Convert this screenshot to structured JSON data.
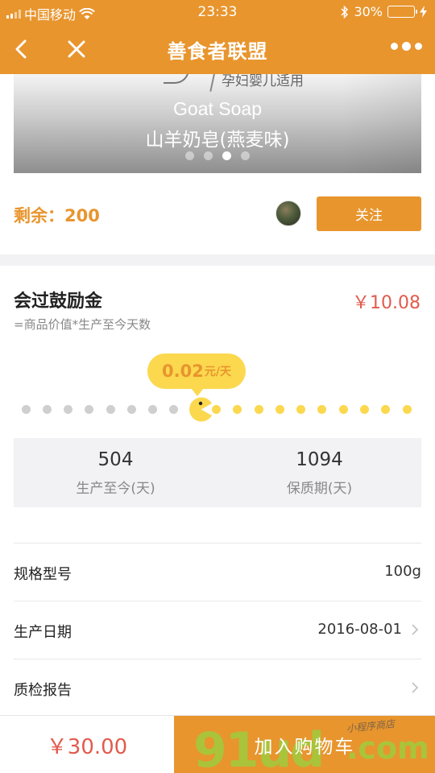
{
  "status": {
    "carrier": "中国移动",
    "time": "23:33",
    "battery": "30%",
    "battery_level": 0.3
  },
  "nav": {
    "title": "善食者联盟",
    "back_icon": "chevron-left-icon",
    "close_icon": "close-icon",
    "more_icon": "more-dots-icon"
  },
  "banner": {
    "small_text": "孕妇婴儿适用",
    "title_en": "Goat Soap",
    "title_cn": "山羊奶皂(燕麦味)",
    "slide_count": 4,
    "active_slide": 3
  },
  "stock": {
    "label": "剩余：200"
  },
  "follow_button": "关注",
  "reward": {
    "title": "会过鼓励金",
    "formula": "=商品价值*生产至今天数",
    "amount": "￥10.08",
    "rate_value": "0.02",
    "rate_unit": "元/天",
    "progress_fraction": 0.46
  },
  "stats": [
    {
      "value": "504",
      "label": "生产至今(天)"
    },
    {
      "value": "1094",
      "label": "保质期(天)"
    }
  ],
  "specs": [
    {
      "key": "规格型号",
      "value": "100g",
      "arrow": false
    },
    {
      "key": "生产日期",
      "value": "2016-08-01",
      "arrow": true
    },
    {
      "key": "质检报告",
      "value": "",
      "arrow": true
    }
  ],
  "bottom": {
    "price": "￥30.00",
    "cart_label": "加入购物车",
    "watermark_main": "91ud",
    "watermark_domain": ".com",
    "watermark_sub": "小程序商店"
  },
  "colors": {
    "brand_orange": "#e8952e",
    "price_red": "#e25b4d",
    "accent_yellow": "#fbd84e"
  }
}
